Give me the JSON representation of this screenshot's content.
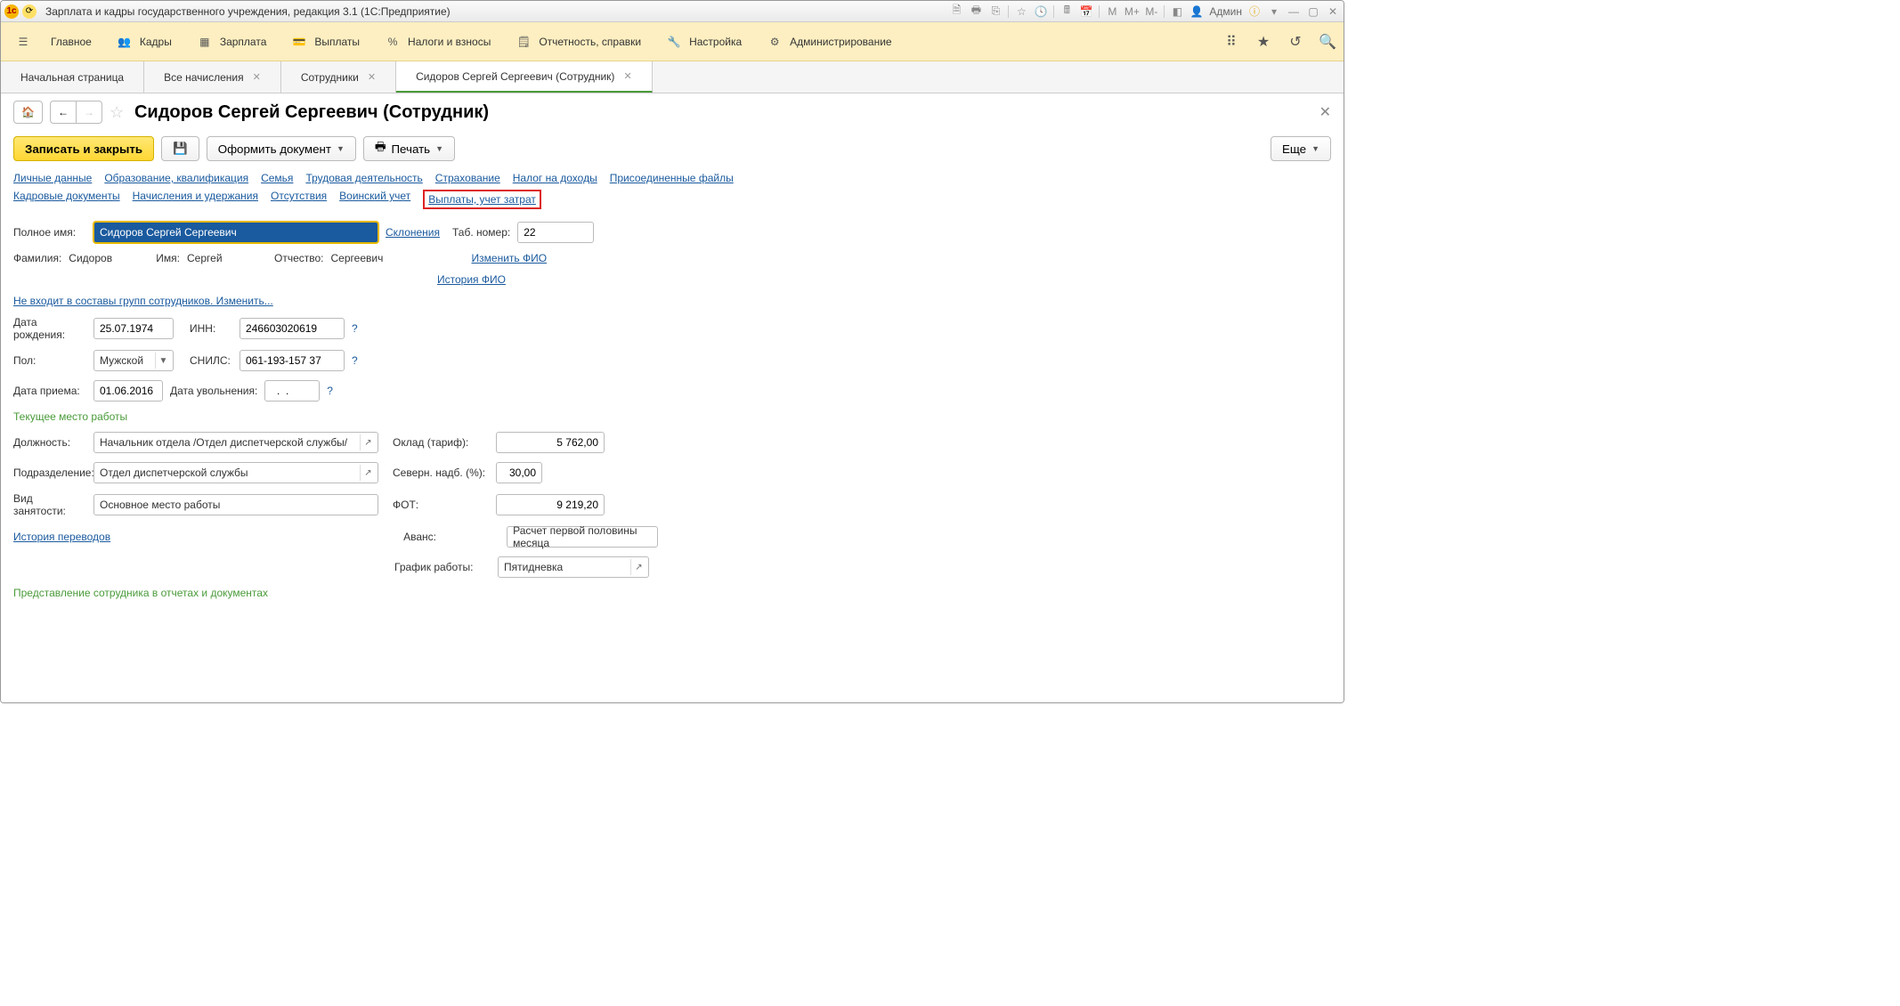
{
  "titleBar": {
    "title": "Зарплата и кадры государственного учреждения, редакция 3.1  (1С:Предприятие)",
    "iconM": "M",
    "iconMplus": "M+",
    "iconMminus": "M-",
    "userIcon": "👤",
    "userName": "Админ"
  },
  "mainMenu": {
    "items": [
      {
        "label": "Главное"
      },
      {
        "label": "Кадры"
      },
      {
        "label": "Зарплата"
      },
      {
        "label": "Выплаты"
      },
      {
        "label": "Налоги и взносы"
      },
      {
        "label": "Отчетность, справки"
      },
      {
        "label": "Настройка"
      },
      {
        "label": "Администрирование"
      }
    ]
  },
  "tabs": [
    {
      "label": "Начальная страница",
      "closable": false,
      "active": false
    },
    {
      "label": "Все начисления",
      "closable": true,
      "active": false
    },
    {
      "label": "Сотрудники",
      "closable": true,
      "active": false
    },
    {
      "label": "Сидоров Сергей Сергеевич (Сотрудник)",
      "closable": true,
      "active": true
    }
  ],
  "page": {
    "title": "Сидоров Сергей Сергеевич (Сотрудник)"
  },
  "actions": {
    "saveClose": "Записать и закрыть",
    "createDoc": "Оформить документ",
    "print": "Печать",
    "more": "Еще"
  },
  "sectionLinks1": [
    "Личные данные",
    "Образование, квалификация",
    "Семья",
    "Трудовая деятельность",
    "Страхование",
    "Налог на доходы",
    "Присоединенные файлы"
  ],
  "sectionLinks2": [
    "Кадровые документы",
    "Начисления и удержания",
    "Отсутствия",
    "Воинский учет"
  ],
  "sectionLinksHighlighted": "Выплаты, учет затрат",
  "form": {
    "fullNameLabel": "Полное имя:",
    "fullName": "Сидоров Сергей Сергеевич",
    "declensionsLink": "Склонения",
    "tabNumLabel": "Таб. номер:",
    "tabNum": "22",
    "surnameLabel": "Фамилия:",
    "surname": "Сидоров",
    "nameLabel": "Имя:",
    "name": "Сергей",
    "patronymicLabel": "Отчество:",
    "patronymic": "Сергеевич",
    "changeFioLink": "Изменить ФИО",
    "historyFioLink": "История ФИО",
    "groupsLink": "Не входит в составы групп сотрудников. Изменить...",
    "birthDateLabel": "Дата рождения:",
    "birthDate": "25.07.1974",
    "innLabel": "ИНН:",
    "inn": "246603020619",
    "sexLabel": "Пол:",
    "sex": "Мужской",
    "snilsLabel": "СНИЛС:",
    "snils": "061-193-157 37",
    "hireDateLabel": "Дата приема:",
    "hireDate": "01.06.2016",
    "fireDateLabel": "Дата увольнения:",
    "fireDate": "  .  .    ",
    "currentJobLabel": "Текущее место работы",
    "positionLabel": "Должность:",
    "position": "Начальник отдела /Отдел диспетчерской службы/",
    "salaryLabel": "Оклад (тариф):",
    "salary": "5 762,00",
    "departmentLabel": "Подразделение:",
    "department": "Отдел диспетчерской службы",
    "northAllowLabel": "Северн. надб. (%):",
    "northAllow": "30,00",
    "employTypeLabel": "Вид занятости:",
    "employType": "Основное место работы",
    "fotLabel": "ФОТ:",
    "fot": "9 219,20",
    "transfersHistoryLink": "История переводов",
    "advanceLabel": "Аванс:",
    "advance": "Расчет первой половины месяца",
    "scheduleLabel": "График работы:",
    "schedule": "Пятидневка",
    "representationLabel": "Представление сотрудника в отчетах и документах"
  }
}
